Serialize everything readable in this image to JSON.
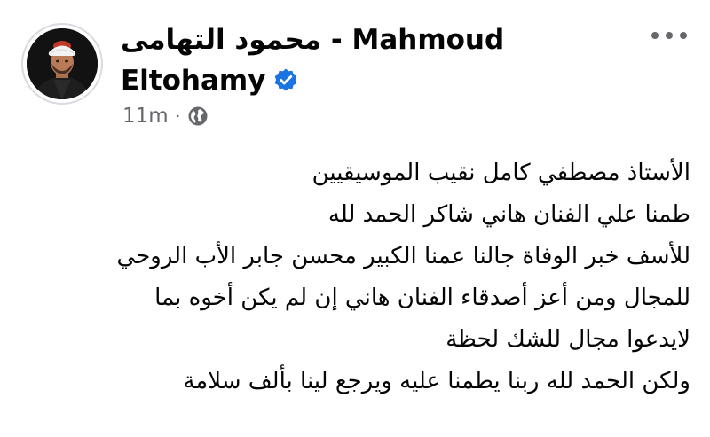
{
  "post": {
    "author_line1": "محمود التهامى - Mahmoud",
    "author_line2": "Eltohamy",
    "verified": true,
    "time": "11m",
    "separator": "·",
    "privacy_icon": "globe-icon",
    "more_icon": "more-options-icon",
    "lines": [
      "الأستاذ مصطفي كامل نقيب الموسيقيين",
      "طمنا علي الفنان هاني شاكر الحمد لله",
      "للأسف خبر الوفاة جالنا عمنا الكبير محسن جابر الأب الروحي",
      "للمجال ومن أعز أصدقاء الفنان هاني إن لم يكن أخوه بما",
      "لايدعوا مجال للشك لحظة",
      "ولكن الحمد لله ربنا يطمنا عليه ويرجع لينا بألف سلامة"
    ]
  },
  "colors": {
    "text": "#050505",
    "secondary": "#65676b",
    "verified_blue": "#1b74e4",
    "avatar_border": "#d7dadf"
  }
}
